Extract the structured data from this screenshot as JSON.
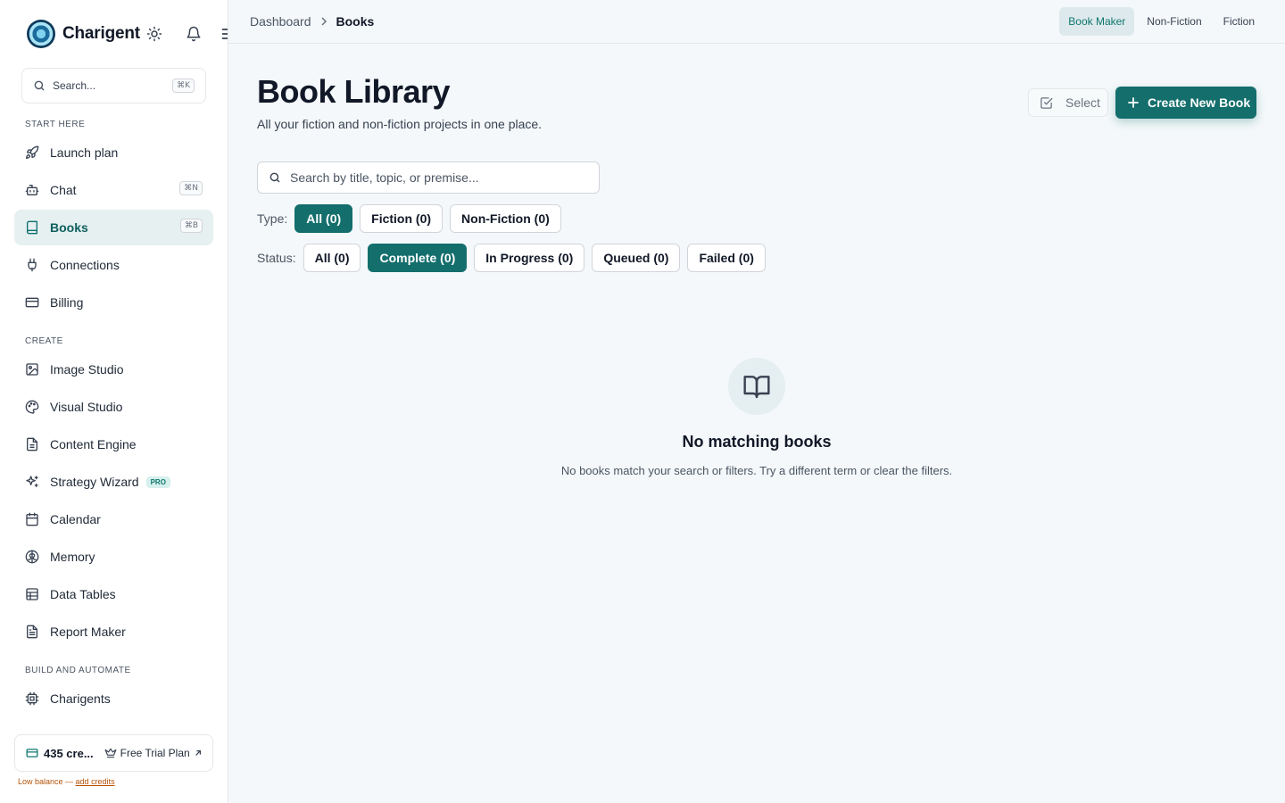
{
  "app": {
    "name": "Charigent"
  },
  "sidebar": {
    "search": {
      "placeholder": "Search...",
      "shortcut": "⌘K"
    },
    "sections": [
      {
        "label": "START HERE"
      },
      {
        "label": "CREATE"
      },
      {
        "label": "BUILD AND AUTOMATE"
      }
    ],
    "items": [
      {
        "label": "Launch plan",
        "icon": "rocket-icon"
      },
      {
        "label": "Chat",
        "icon": "bot-icon",
        "shortcut": "⌘N"
      },
      {
        "label": "Books",
        "icon": "book-icon",
        "shortcut": "⌘B",
        "active": true
      },
      {
        "label": "Connections",
        "icon": "plug-icon"
      },
      {
        "label": "Billing",
        "icon": "credit-card-icon"
      },
      {
        "label": "Image Studio",
        "icon": "image-icon"
      },
      {
        "label": "Visual Studio",
        "icon": "palette-icon"
      },
      {
        "label": "Content Engine",
        "icon": "file-text-icon"
      },
      {
        "label": "Strategy Wizard",
        "icon": "sparkles-icon",
        "badge": "PRO"
      },
      {
        "label": "Calendar",
        "icon": "calendar-icon"
      },
      {
        "label": "Memory",
        "icon": "brain-icon"
      },
      {
        "label": "Data Tables",
        "icon": "table-icon"
      },
      {
        "label": "Report Maker",
        "icon": "report-icon"
      },
      {
        "label": "Charigents",
        "icon": "cpu-icon"
      }
    ],
    "credits": {
      "text": "435 cre...",
      "plan": "Free Trial Plan"
    },
    "low_balance": {
      "text": "Low balance — ",
      "link": "add credits"
    }
  },
  "topbar": {
    "breadcrumb": [
      "Dashboard",
      "Books"
    ],
    "tabs": [
      {
        "label": "Book Maker",
        "active": true
      },
      {
        "label": "Non-Fiction"
      },
      {
        "label": "Fiction"
      }
    ]
  },
  "main": {
    "title": "Book Library",
    "subtitle": "All your fiction and non-fiction projects in one place.",
    "select_label": "Select",
    "create_label": "Create New Book",
    "search_placeholder": "Search by title, topic, or premise...",
    "type_filter": {
      "label": "Type:",
      "options": [
        {
          "label": "All (0)",
          "active": true
        },
        {
          "label": "Fiction (0)"
        },
        {
          "label": "Non-Fiction (0)"
        }
      ]
    },
    "status_filter": {
      "label": "Status:",
      "options": [
        {
          "label": "All (0)"
        },
        {
          "label": "Complete (0)",
          "active": true
        },
        {
          "label": "In Progress (0)"
        },
        {
          "label": "Queued (0)"
        },
        {
          "label": "Failed (0)"
        }
      ]
    },
    "empty_state": {
      "title": "No matching books",
      "description": "No books match your search or filters. Try a different term or clear the filters."
    }
  },
  "colors": {
    "accent": "#136e6c",
    "active_nav_bg": "#e6f0f0",
    "warning": "#b45309"
  }
}
